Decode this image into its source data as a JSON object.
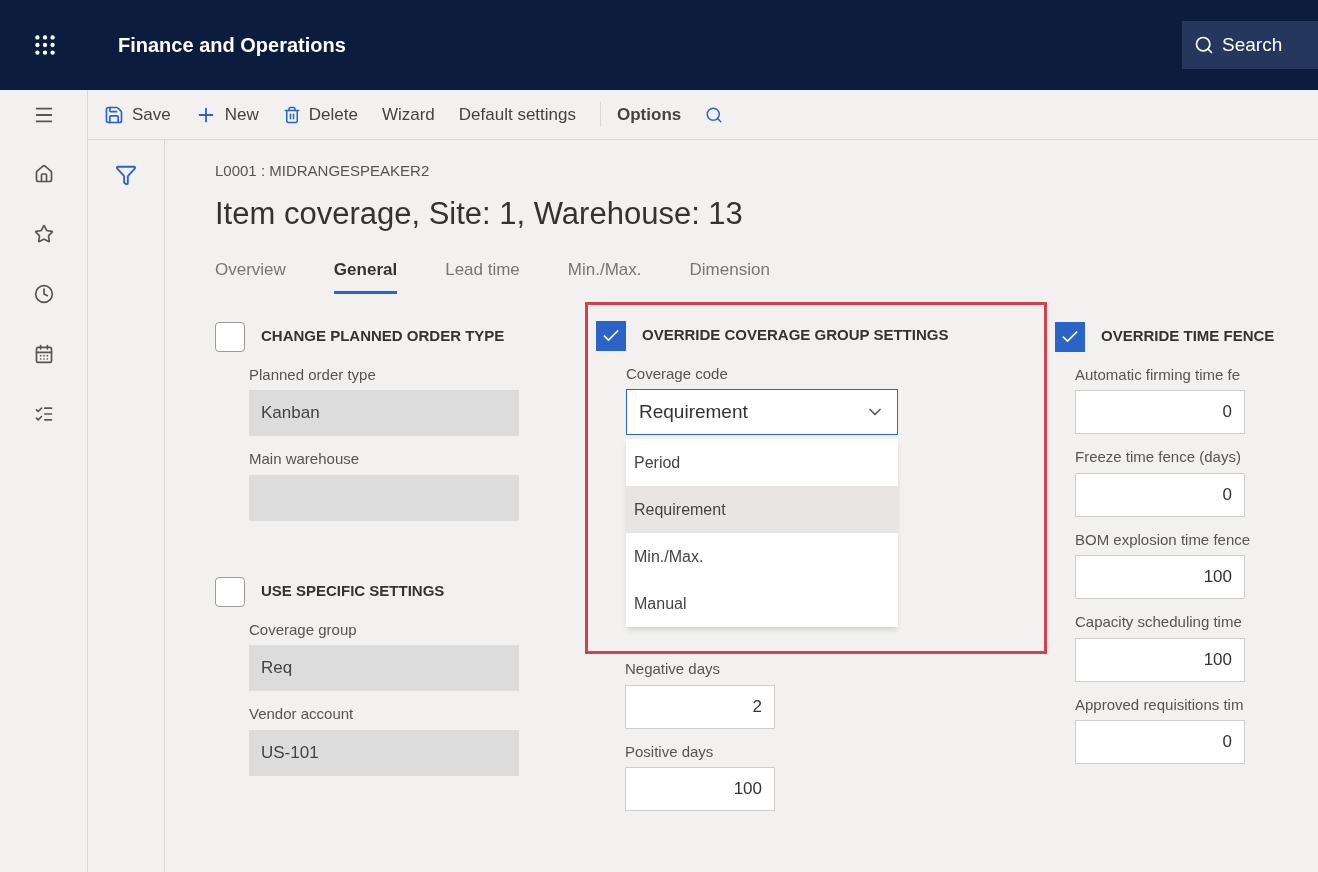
{
  "app_bar": {
    "title": "Finance and Operations",
    "search": {
      "placeholder": "Search"
    }
  },
  "toolbar": [
    {
      "kind": "save",
      "label": "Save"
    },
    {
      "kind": "new",
      "label": "New"
    },
    {
      "kind": "delete",
      "label": "Delete"
    },
    {
      "kind": "plain",
      "label": "Wizard"
    },
    {
      "kind": "plain",
      "label": "Default settings"
    },
    {
      "kind": "bold",
      "label": "Options"
    },
    {
      "kind": "search"
    }
  ],
  "nav_rail": [
    {
      "kind": "home"
    },
    {
      "kind": "star"
    },
    {
      "kind": "clock"
    },
    {
      "kind": "calendar"
    },
    {
      "kind": "list"
    }
  ],
  "record": {
    "caption": "L0001 : MIDRANGESPEAKER2",
    "title": "Item coverage, Site: 1, Warehouse: 13"
  },
  "tabs": [
    {
      "label": "Overview",
      "selected": false
    },
    {
      "label": "General",
      "selected": true
    },
    {
      "label": "Lead time",
      "selected": false
    },
    {
      "label": "Min./Max.",
      "selected": false
    },
    {
      "label": "Dimension",
      "selected": false
    }
  ],
  "left_groups": [
    {
      "title": "CHANGE PLANNED ORDER TYPE",
      "checked": false,
      "fields": [
        {
          "label": "Planned order type",
          "value": "Kanban"
        },
        {
          "label": "Main warehouse"
        }
      ]
    },
    {
      "title": "USE SPECIFIC SETTINGS",
      "checked": false,
      "fields": [
        {
          "label": "Coverage group",
          "value": "Req"
        },
        {
          "label": "Vendor account",
          "value": "US-101"
        }
      ]
    }
  ],
  "coverage_group": {
    "title": "OVERRIDE COVERAGE GROUP SETTINGS",
    "checked": true,
    "highlighted": true,
    "coverage_code": {
      "label": "Coverage code",
      "value": "Requirement",
      "expanded": true,
      "options": [
        {
          "label": "Period",
          "selected": false
        },
        {
          "label": "Requirement",
          "selected": true
        },
        {
          "label": "Min./Max.",
          "selected": false
        },
        {
          "label": "Manual",
          "selected": false
        }
      ]
    },
    "fields": [
      {
        "label": "Negative days",
        "value": "2"
      },
      {
        "label": "Positive days",
        "value": "100"
      }
    ]
  },
  "time_fences": {
    "title": "OVERRIDE TIME FENCE",
    "checked": true,
    "fields": [
      {
        "label": "Automatic firming time fe",
        "value": "0"
      },
      {
        "label": "Freeze time fence (days)",
        "value": "0"
      },
      {
        "label": "BOM explosion time fence",
        "value": "100"
      },
      {
        "label": "Capacity scheduling time",
        "value": "100"
      },
      {
        "label": "Approved requisitions tim",
        "value": "0"
      }
    ]
  }
}
